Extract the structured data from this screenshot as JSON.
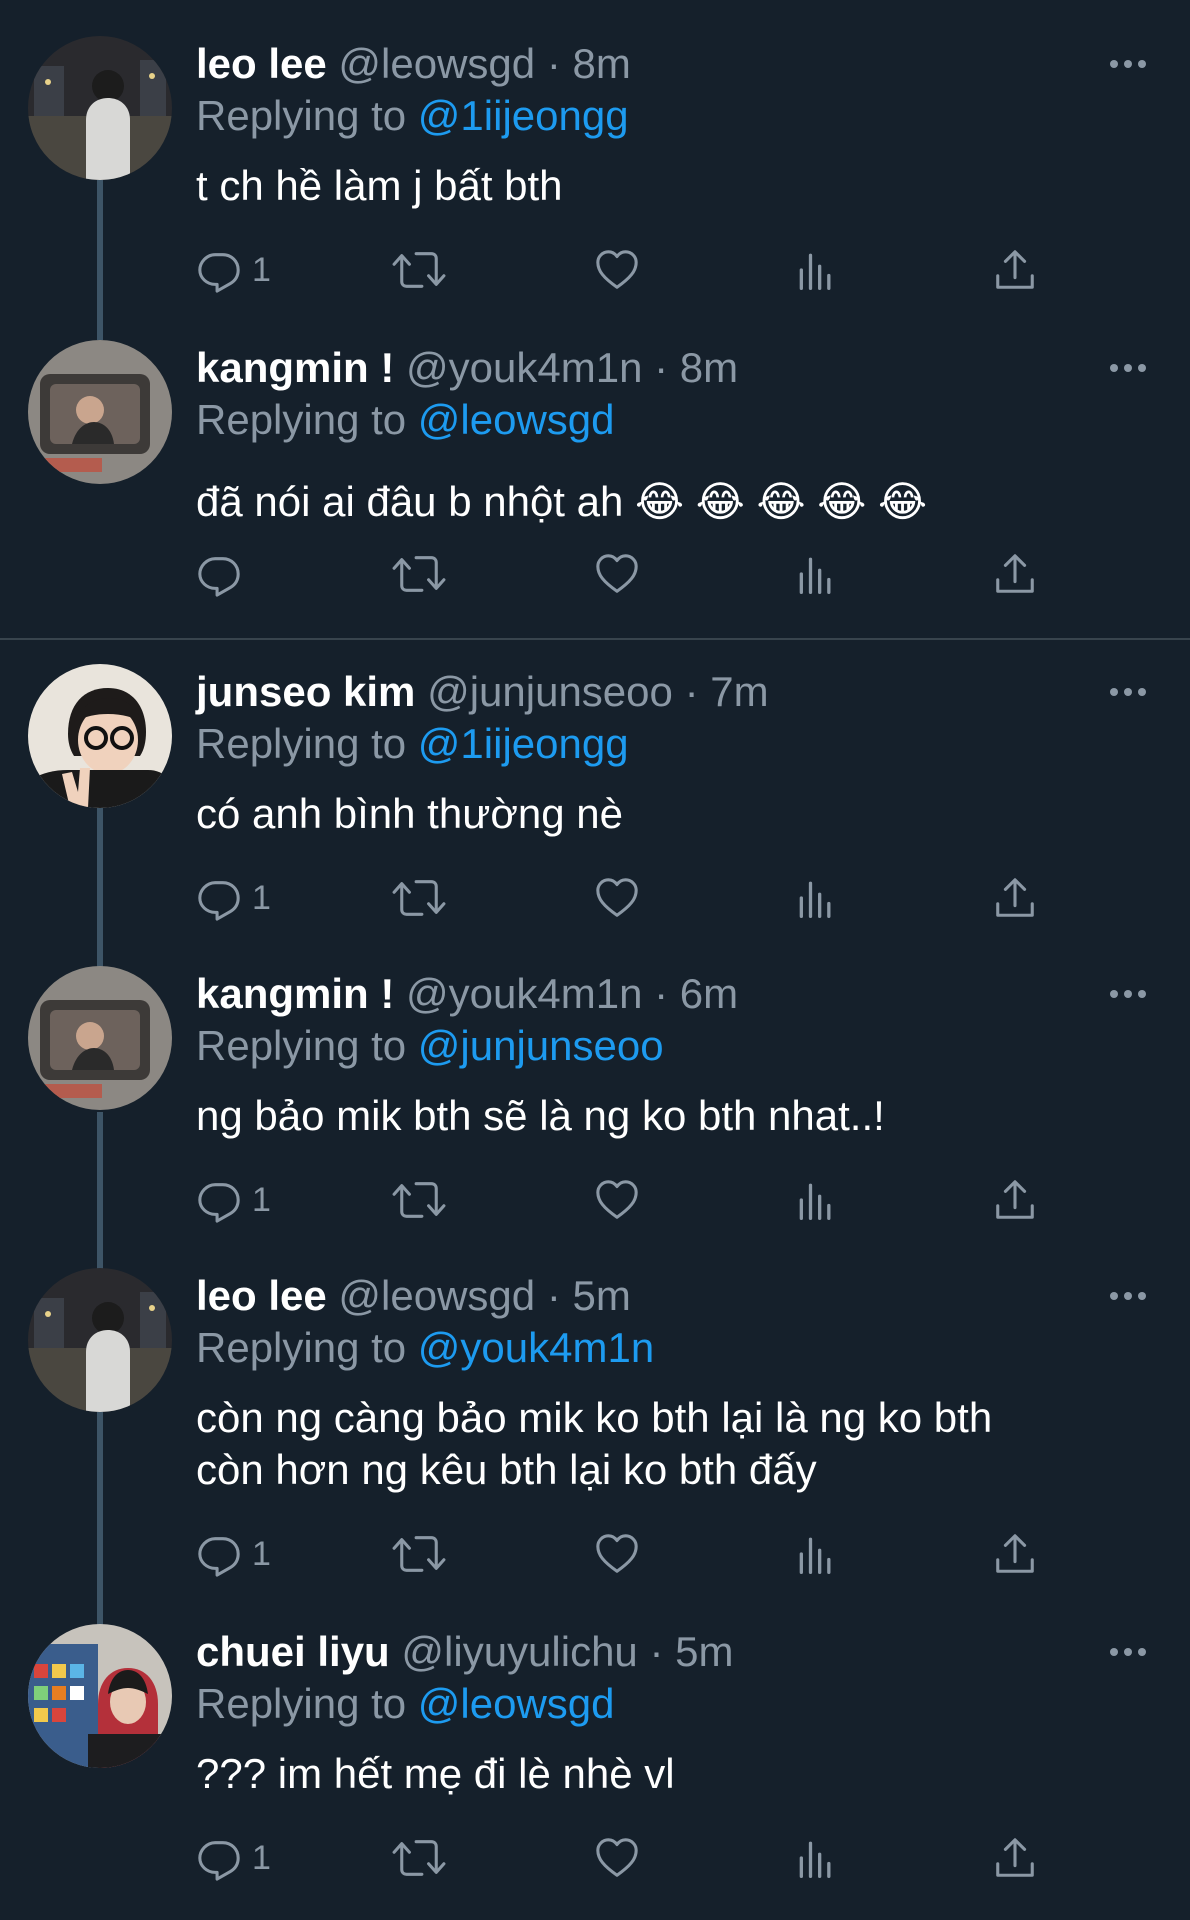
{
  "replying_prefix": "Replying to",
  "tweets": [
    {
      "name": "leo lee",
      "handle": "@leowsgd",
      "dot": "·",
      "time": "8m",
      "replying_to": "@1iijeongg",
      "text": "t ch hề làm j bất bth",
      "reply_count": "1"
    },
    {
      "name": "kangmin !",
      "handle": "@youk4m1n",
      "dot": "·",
      "time": "8m",
      "replying_to": "@leowsgd",
      "text": "đã nói ai đâu b nhột ah 😂 😂 😂 😂 😂",
      "reply_count": ""
    },
    {
      "name": "junseo kim",
      "handle": "@junjunseoo",
      "dot": "·",
      "time": "7m",
      "replying_to": "@1iijeongg",
      "text": "có anh bình thường nè",
      "reply_count": "1"
    },
    {
      "name": "kangmin !",
      "handle": "@youk4m1n",
      "dot": "·",
      "time": "6m",
      "replying_to": "@junjunseoo",
      "text": "ng bảo mik bth sẽ là ng ko bth nhat..!",
      "reply_count": "1"
    },
    {
      "name": "leo lee",
      "handle": "@leowsgd",
      "dot": "·",
      "time": "5m",
      "replying_to": "@youk4m1n",
      "text": "còn ng càng bảo mik ko bth lại là ng ko bth\ncòn hơn ng kêu bth lại ko bth đấy",
      "reply_count": "1"
    },
    {
      "name": "chuei liyu",
      "handle": "@liyuyulichu",
      "dot": "·",
      "time": "5m",
      "replying_to": "@leowsgd",
      "text": "??? im hết mẹ đi lè nhè vl",
      "reply_count": "1"
    }
  ],
  "icons": {
    "more": "more-horizontal-icon",
    "reply": "reply-icon",
    "retweet": "retweet-icon",
    "like": "heart-icon",
    "views": "views-icon",
    "share": "share-icon"
  },
  "colors": {
    "background": "#15202b",
    "text": "#ffffff",
    "muted": "#8b98a5",
    "mention": "#1d9bf0",
    "thread_line": "#3d5466",
    "divider": "#38444d"
  }
}
